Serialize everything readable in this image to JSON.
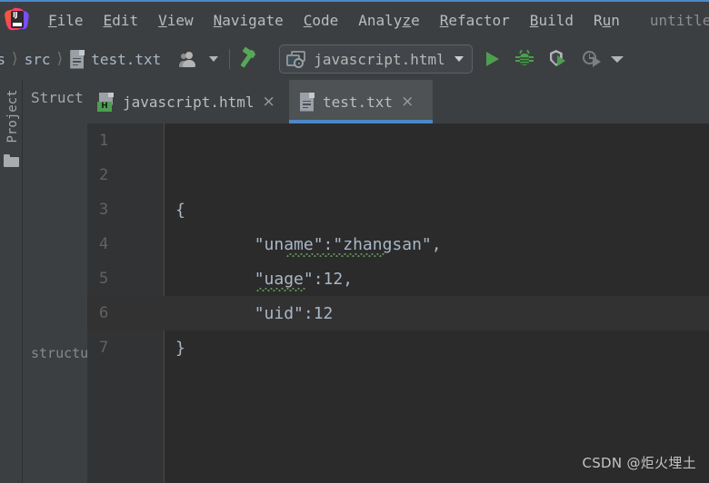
{
  "window": {
    "title": "untitled",
    "accent_color": "#4a88c7",
    "chrome_bg": "#3c3f41",
    "editor_bg": "#2b2b2b",
    "gutter_bg": "#313335"
  },
  "menubar": {
    "logo_text": "IJ",
    "items": [
      {
        "label": "File",
        "mnemonic": "F"
      },
      {
        "label": "Edit",
        "mnemonic": "E"
      },
      {
        "label": "View",
        "mnemonic": "V"
      },
      {
        "label": "Navigate",
        "mnemonic": "N"
      },
      {
        "label": "Code",
        "mnemonic": "C"
      },
      {
        "label": "Analyze",
        "mnemonic": "z"
      },
      {
        "label": "Refactor",
        "mnemonic": "R"
      },
      {
        "label": "Build",
        "mnemonic": "B"
      },
      {
        "label": "Run",
        "mnemonic": "u"
      }
    ]
  },
  "toolbar": {
    "breadcrumb": {
      "clipped_prefix": "s",
      "separator": "〉",
      "items": [
        "src",
        "test.txt"
      ],
      "file_icon": "text-file-icon"
    },
    "vcs_icon": "vcs-users-icon",
    "build_icon": "hammer-icon",
    "run_config": {
      "icon": "browser-globe-icon",
      "label": "javascript.html",
      "caret": "chevron-down-icon"
    },
    "actions": [
      {
        "name": "run-button",
        "icon": "play-icon",
        "enabled": true
      },
      {
        "name": "debug-button",
        "icon": "bug-icon",
        "enabled": true
      },
      {
        "name": "run-coverage-button",
        "icon": "shield-play-icon",
        "enabled": true
      },
      {
        "name": "profile-button",
        "icon": "profiler-clock-icon",
        "enabled": false
      }
    ],
    "overflow_caret": "chevron-down-icon"
  },
  "left_strip": {
    "project_label": "Project",
    "folder_icon": "folder-icon"
  },
  "structure_panel": {
    "title": "Struct",
    "bottom_label": "structu"
  },
  "tabs": [
    {
      "label": "javascript.html",
      "icon": "html-file-icon",
      "icon_badge": "H",
      "active": false,
      "close": "×"
    },
    {
      "label": "test.txt",
      "icon": "text-file-icon",
      "active": true,
      "close": "×"
    }
  ],
  "editor": {
    "current_line": 6,
    "lines": [
      {
        "number": "1",
        "text": ""
      },
      {
        "number": "2",
        "text": ""
      },
      {
        "number": "3",
        "text": "{"
      },
      {
        "number": "4",
        "text": "        \"uname\":\"zhangsan\","
      },
      {
        "number": "5",
        "text": "        \"uage\":12,"
      },
      {
        "number": "6",
        "text": "        \"uid\":12"
      },
      {
        "number": "7",
        "text": "}"
      }
    ],
    "spellcheck_words": [
      "zhangsan",
      "uage"
    ],
    "spellcheck_color": "#629755"
  },
  "watermark": {
    "text": "CSDN @炬火埋土"
  }
}
